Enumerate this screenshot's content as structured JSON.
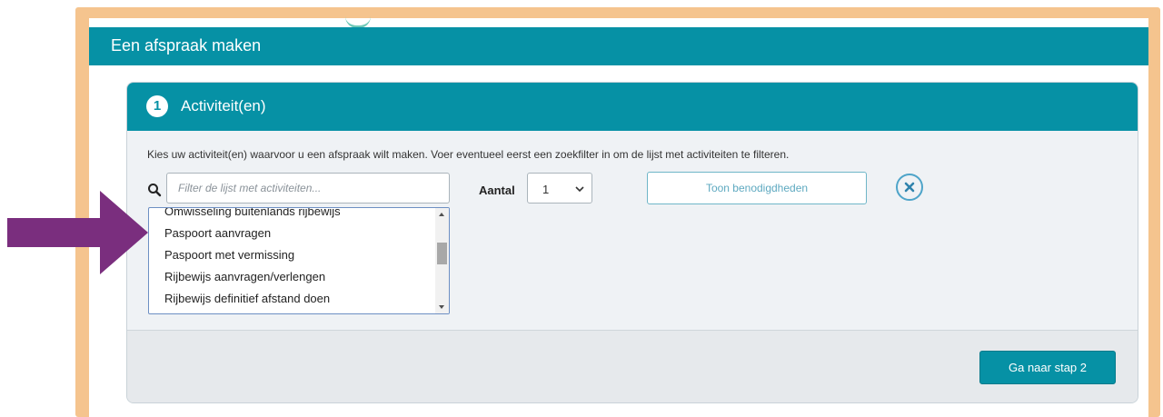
{
  "page": {
    "title": "Een afspraak maken"
  },
  "step": {
    "number": "1",
    "title": "Activiteit(en)",
    "instructions": "Kies uw activiteit(en) waarvoor u een afspraak wilt maken. Voer eventueel eerst een zoekfilter in om de lijst met activiteiten te filteren."
  },
  "filter": {
    "placeholder": "Filter de lijst met activiteiten...",
    "value": ""
  },
  "aantal": {
    "label": "Aantal",
    "selected": "1"
  },
  "buttons": {
    "toon": "Toon benodigdheden",
    "next": "Ga naar stap 2"
  },
  "activities": [
    "Omwisseling buitenlands rijbewijs",
    "Paspoort aanvragen",
    "Paspoort met vermissing",
    "Rijbewijs aanvragen/verlengen",
    "Rijbewijs definitief afstand doen"
  ],
  "colors": {
    "frame": "#f5c48e",
    "header": "#0691a5",
    "annotation_arrow": "#7a2e7e"
  },
  "icons": [
    "search-icon",
    "chevron-down-icon",
    "clear-icon",
    "annotation-arrow"
  ]
}
